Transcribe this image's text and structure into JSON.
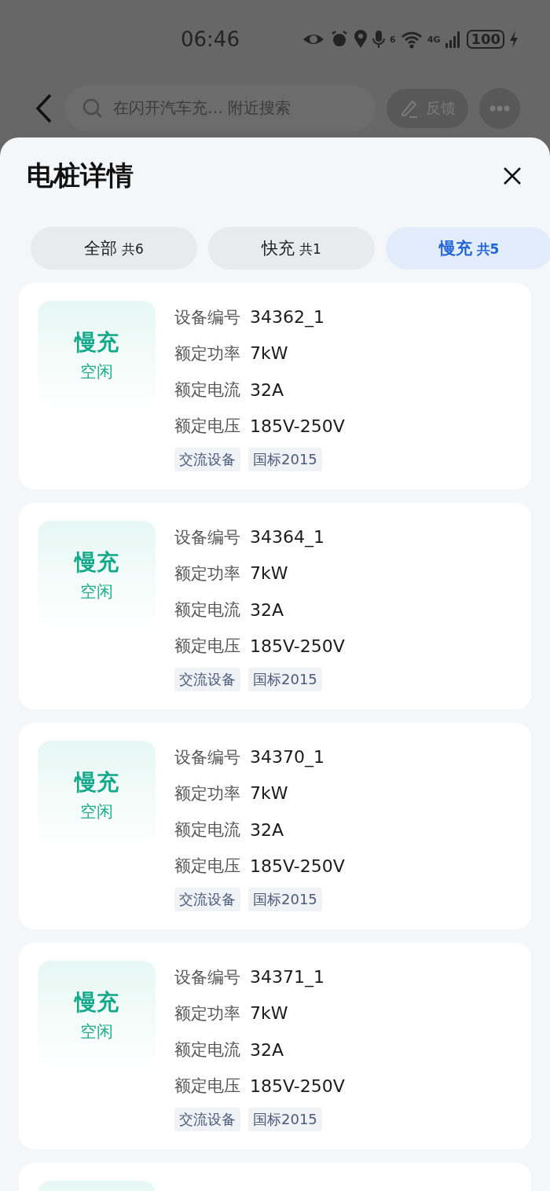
{
  "status_bar": {
    "time": "06:46",
    "wifi_label": "6",
    "network": "4G",
    "battery": "100"
  },
  "header": {
    "search_placeholder": "在闪开汽车充… 附近搜索",
    "feedback": "反馈"
  },
  "sheet": {
    "title": "电桩详情"
  },
  "tabs": [
    {
      "label": "全部",
      "count": "共6",
      "selected": false
    },
    {
      "label": "快充",
      "count": "共1",
      "selected": false
    },
    {
      "label": "慢充",
      "count": "共5",
      "selected": true
    }
  ],
  "chargers": [
    {
      "type": "慢充",
      "status": "空闲",
      "fields": [
        {
          "label": "设备编号",
          "value": "34362_1"
        },
        {
          "label": "额定功率",
          "value": "7kW"
        },
        {
          "label": "额定电流",
          "value": "32A"
        },
        {
          "label": "额定电压",
          "value": "185V-250V"
        }
      ],
      "tags": [
        "交流设备",
        "国标2015"
      ]
    },
    {
      "type": "慢充",
      "status": "空闲",
      "fields": [
        {
          "label": "设备编号",
          "value": "34364_1"
        },
        {
          "label": "额定功率",
          "value": "7kW"
        },
        {
          "label": "额定电流",
          "value": "32A"
        },
        {
          "label": "额定电压",
          "value": "185V-250V"
        }
      ],
      "tags": [
        "交流设备",
        "国标2015"
      ]
    },
    {
      "type": "慢充",
      "status": "空闲",
      "fields": [
        {
          "label": "设备编号",
          "value": "34370_1"
        },
        {
          "label": "额定功率",
          "value": "7kW"
        },
        {
          "label": "额定电流",
          "value": "32A"
        },
        {
          "label": "额定电压",
          "value": "185V-250V"
        }
      ],
      "tags": [
        "交流设备",
        "国标2015"
      ]
    },
    {
      "type": "慢充",
      "status": "空闲",
      "fields": [
        {
          "label": "设备编号",
          "value": "34371_1"
        },
        {
          "label": "额定功率",
          "value": "7kW"
        },
        {
          "label": "额定电流",
          "value": "32A"
        },
        {
          "label": "额定电压",
          "value": "185V-250V"
        }
      ],
      "tags": [
        "交流设备",
        "国标2015"
      ]
    },
    {
      "kind": "partial"
    }
  ]
}
